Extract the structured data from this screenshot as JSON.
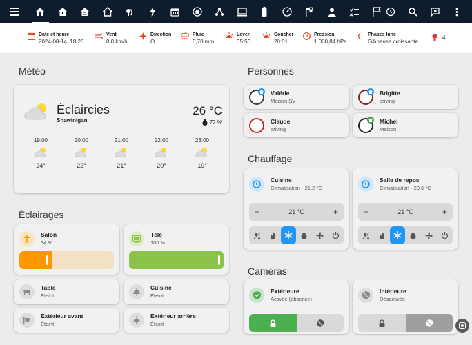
{
  "status": {
    "date": {
      "label": "Date et heure",
      "value": "2024-08-14, 18:26"
    },
    "wind": {
      "label": "Vent",
      "value": "0,0 km/h"
    },
    "direction": {
      "label": "Direction",
      "value": "O"
    },
    "rain": {
      "label": "Pluie",
      "value": "0,78 mm"
    },
    "sunrise": {
      "label": "Lever",
      "value": "05:50"
    },
    "sunset": {
      "label": "Coucher",
      "value": "20:01"
    },
    "pressure": {
      "label": "Pression",
      "value": "1 000,84 hPa"
    },
    "moon": {
      "label": "Phases lune",
      "value": "Gibbeuse croissante"
    },
    "alerts": {
      "value": "4"
    }
  },
  "weather": {
    "section_title": "Météo",
    "condition": "Éclaircies",
    "location": "Shawinigan",
    "temperature": "26 °C",
    "humidity": "72 %",
    "forecast": [
      {
        "time": "19:00",
        "temp": "24°"
      },
      {
        "time": "20:00",
        "temp": "22°"
      },
      {
        "time": "21:00",
        "temp": "21°"
      },
      {
        "time": "22:00",
        "temp": "20°"
      },
      {
        "time": "23:00",
        "temp": "19°"
      }
    ]
  },
  "lights": {
    "section_title": "Éclairages",
    "items": [
      {
        "name": "Salon",
        "state": "34 %",
        "brightness": 0.34,
        "color": "#ff9800"
      },
      {
        "name": "Télé",
        "state": "100 %",
        "brightness": 1.0,
        "color": "#8bc34a"
      },
      {
        "name": "Table",
        "state": "Éteint"
      },
      {
        "name": "Cuisine",
        "state": "Éteint"
      },
      {
        "name": "Extérieur avant",
        "state": "Éteint"
      },
      {
        "name": "Extérieur arrière",
        "state": "Éteint"
      }
    ]
  },
  "persons": {
    "section_title": "Personnes",
    "items": [
      {
        "name": "Valérie",
        "state": "Maison SV"
      },
      {
        "name": "Brigitte",
        "state": "driving"
      },
      {
        "name": "Claude",
        "state": "driving"
      },
      {
        "name": "Michel",
        "state": "Maison"
      }
    ]
  },
  "heating": {
    "section_title": "Chauffage",
    "items": [
      {
        "name": "Cuisine",
        "state": "Climatisation · 21,2 °C",
        "setpoint": "21 °C"
      },
      {
        "name": "Salle de repos",
        "state": "Climatisation · 20,6 °C",
        "setpoint": "21 °C"
      }
    ],
    "minus": "−",
    "plus": "+"
  },
  "cameras": {
    "section_title": "Caméras",
    "items": [
      {
        "name": "Extérieure",
        "state": "Activée (absence)"
      },
      {
        "name": "Intérieure",
        "state": "Désactivée"
      }
    ]
  },
  "colors": {
    "topbar": "#0f1c2e",
    "accent_blue": "#2196f3",
    "alarm_green": "#4caf50",
    "salon_orange": "#ff9800",
    "tele_green": "#8bc34a"
  }
}
